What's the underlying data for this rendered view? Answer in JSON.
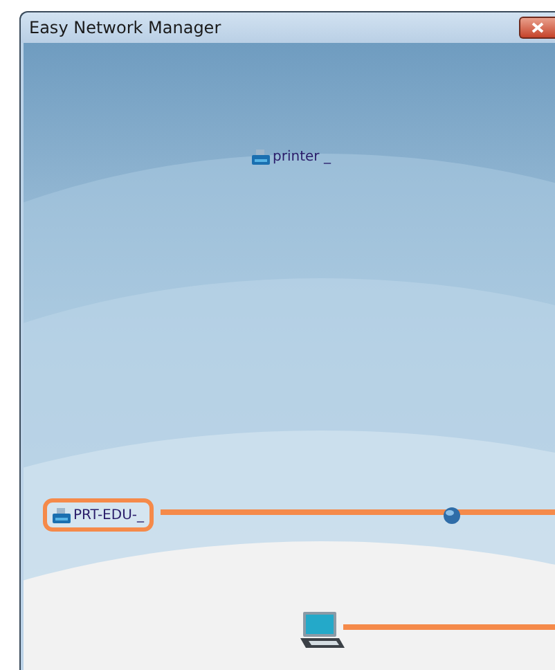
{
  "window": {
    "title": "Easy Network Manager"
  },
  "nodes": [
    {
      "kind": "printer",
      "label": "printer _",
      "highlighted": false
    },
    {
      "kind": "printer",
      "label": "PRT-EDU-_",
      "highlighted": true
    },
    {
      "kind": "globe",
      "highlighted": false
    },
    {
      "kind": "laptop",
      "highlighted": false
    }
  ]
}
